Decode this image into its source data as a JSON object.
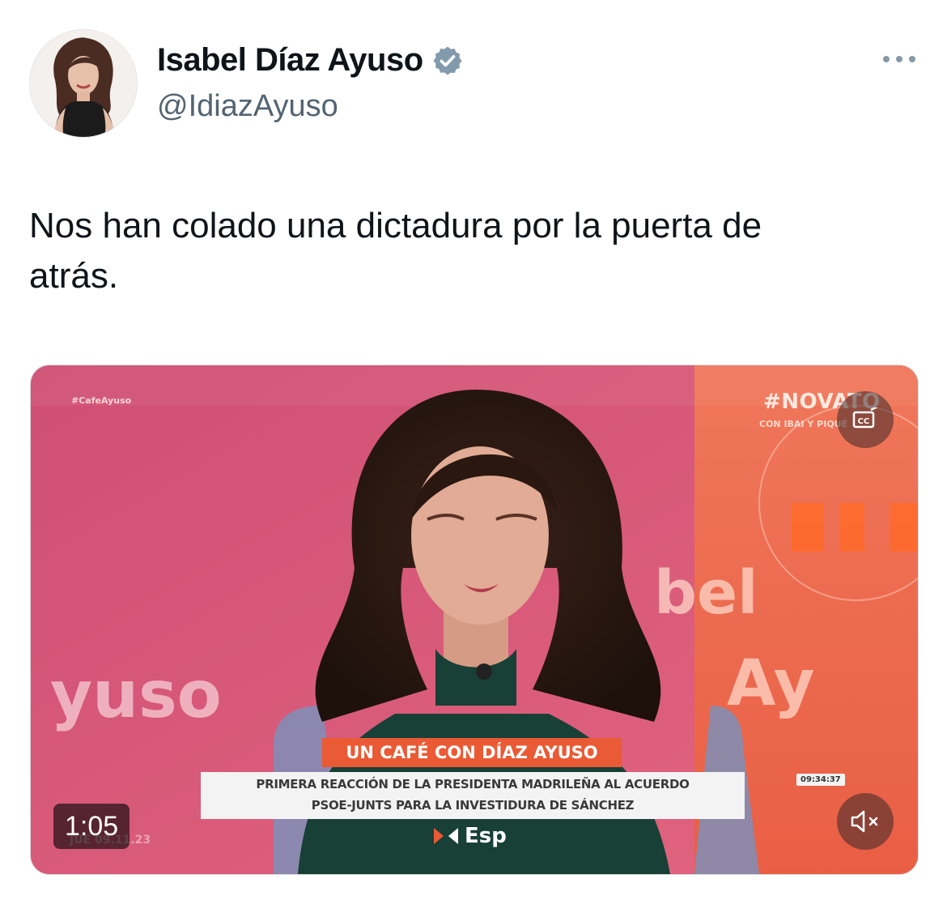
{
  "user": {
    "display_name": "Isabel Díaz Ayuso",
    "handle": "@IdiazAyuso",
    "verified_icon": "verified-badge-icon"
  },
  "menu_icon": "more-options-icon",
  "tweet": {
    "text_line1": "Nos han colado una dictadura por la puerta de",
    "text_line2": "atrás."
  },
  "video": {
    "duration": "1:05",
    "overlay": {
      "hashtag": "#CafeAyuso",
      "show_name": "#NOVATO",
      "show_sub": "CON IBAI Y PIQUÉ",
      "bg_word_left": "yuso",
      "bg_word_right_top": "bel",
      "bg_word_right_bottom": "Ay",
      "banner_title": "UN CAFÉ CON DÍAZ AYUSO",
      "banner_line1": "PRIMERA REACCIÓN DE LA PRESIDENTA MADRILEÑA AL ACUERDO",
      "banner_line2": "PSOE-JUNTS PARA LA INVESTIDURA DE SÁNCHEZ",
      "clock": "09:34:37",
      "date": "JUE 09.11.23",
      "channel": "Esp"
    },
    "buttons": {
      "captions_icon": "closed-captions-icon",
      "mute_icon": "volume-muted-icon"
    }
  },
  "colors": {
    "text_primary": "#0f1419",
    "text_secondary": "#536471",
    "verified": "#829aab",
    "banner_orange": "#ea5a35",
    "bg_pink": "#d9577a",
    "bg_coral": "#ee6a4c"
  }
}
